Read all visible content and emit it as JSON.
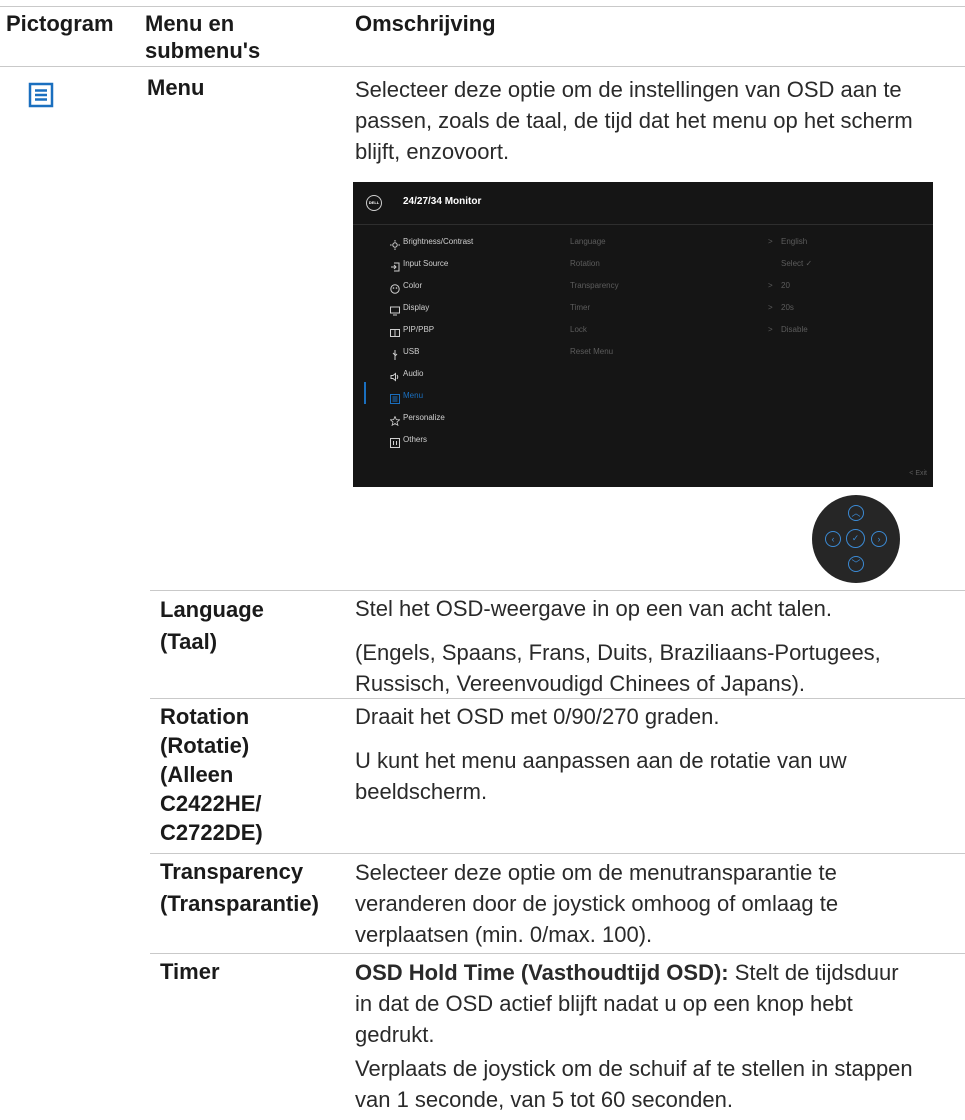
{
  "header": {
    "col1": "Pictogram",
    "col2": "Menu en submenu's",
    "col3": "Omschrijving"
  },
  "menu": {
    "name": "Menu",
    "desc": "Selecteer deze optie om de instellingen van OSD aan te passen, zoals de taal, de tijd dat het menu op het scherm blijft, enzovoort.",
    "icon": "menu-icon",
    "accent": "#1a6fbf"
  },
  "osd": {
    "logo": "DELL",
    "title": "24/27/34 Monitor",
    "menu_items": [
      {
        "label": "Brightness/Contrast",
        "icon": "brightness-icon"
      },
      {
        "label": "Input Source",
        "icon": "input-source-icon"
      },
      {
        "label": "Color",
        "icon": "color-icon"
      },
      {
        "label": "Display",
        "icon": "display-icon"
      },
      {
        "label": "PIP/PBP",
        "icon": "pip-icon"
      },
      {
        "label": "USB",
        "icon": "usb-icon"
      },
      {
        "label": "Audio",
        "icon": "audio-icon"
      },
      {
        "label": "Menu",
        "icon": "menu-icon",
        "selected": true
      },
      {
        "label": "Personalize",
        "icon": "star-icon"
      },
      {
        "label": "Others",
        "icon": "others-icon"
      }
    ],
    "sub_items": [
      {
        "label": "Language",
        "arrow": ">",
        "value": "English"
      },
      {
        "label": "Rotation",
        "arrow": "",
        "value": "Select ✓"
      },
      {
        "label": "Transparency",
        "arrow": ">",
        "value": "20"
      },
      {
        "label": "Timer",
        "arrow": ">",
        "value": "20s"
      },
      {
        "label": "Lock",
        "arrow": ">",
        "value": "Disable"
      },
      {
        "label": "Reset Menu",
        "arrow": "",
        "value": ""
      }
    ],
    "exit": "< Exit"
  },
  "rows": {
    "language": {
      "name_l1": "Language",
      "name_l2": "(Taal)",
      "p1": "Stel het OSD-weergave in op een van acht talen.",
      "p2": "(Engels, Spaans, Frans, Duits, Braziliaans-Portugees, Russisch, Vereenvoudigd Chinees of Japans)."
    },
    "rotation": {
      "name_lines": [
        "Rotation",
        "(Rotatie)",
        "(Alleen",
        "C2422HE/",
        "C2722DE)"
      ],
      "p1": "Draait het OSD met 0/90/270 graden.",
      "p2": "U kunt het menu aanpassen aan de rotatie van uw beeldscherm."
    },
    "transparency": {
      "name_l1": "Transparency",
      "name_l2": "(Transparantie)",
      "p1": "Selecteer deze optie om de menutransparantie te veranderen door de joystick omhoog of omlaag te verplaatsen (min. 0/max. 100)."
    },
    "timer": {
      "name": "Timer",
      "p1_bold": "OSD Hold Time (Vasthoudtijd OSD):",
      "p1_rest": " Stelt de tijdsduur in dat de OSD actief blijft nadat u op een knop hebt gedrukt.",
      "p2": "Verplaats de joystick om de schuif af te stellen in stappen van 1 seconde, van 5 tot 60 seconden."
    }
  }
}
